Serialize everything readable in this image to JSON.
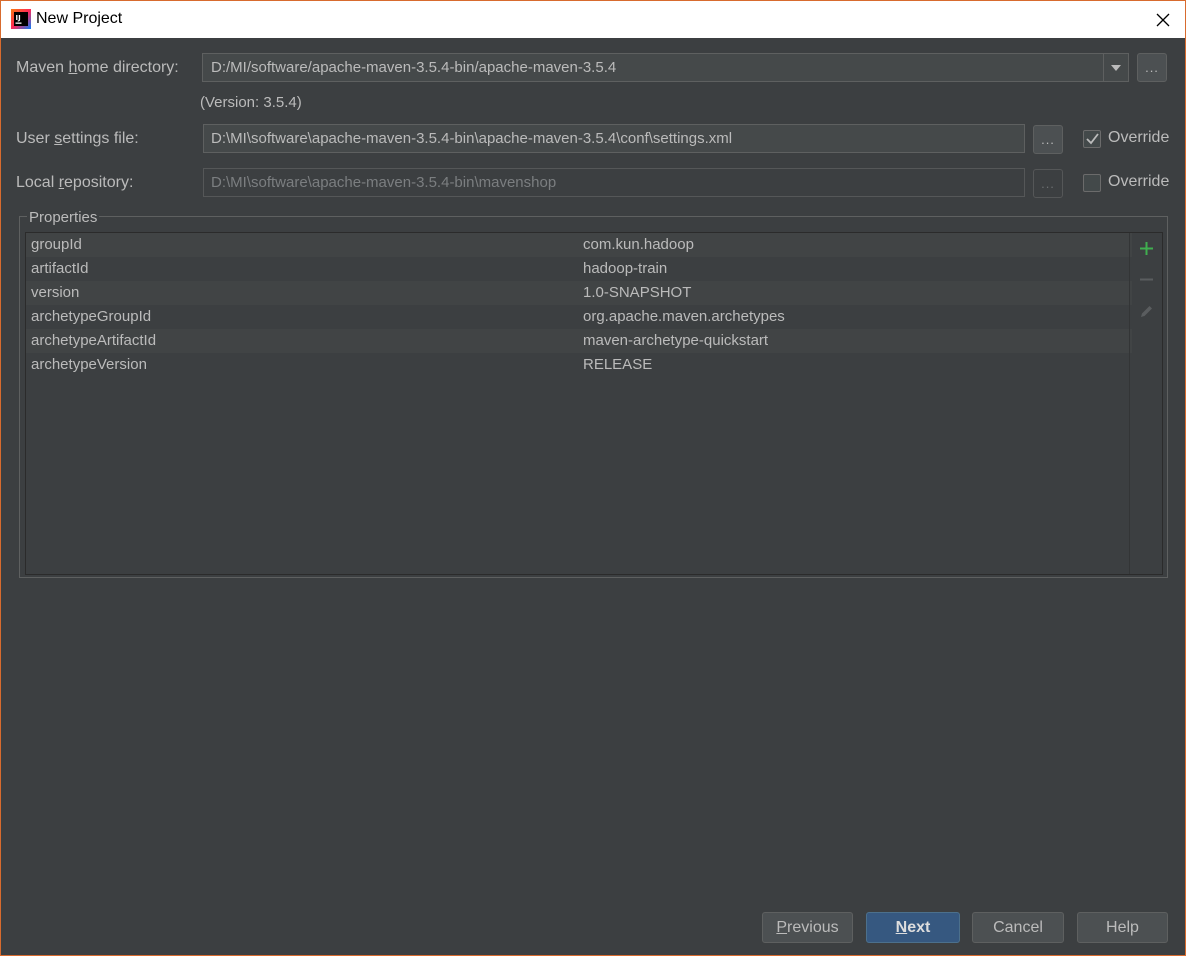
{
  "window": {
    "title": "New Project",
    "accent_color": "#d86b2e",
    "app_icon": "intellij-idea-icon"
  },
  "maven_home": {
    "label_pre": "Maven ",
    "label_mnemonic": "h",
    "label_post": "ome directory:",
    "value": "D:/MI/software/apache-maven-3.5.4-bin/apache-maven-3.5.4",
    "version_text": "(Version: 3.5.4)",
    "browse_label": "..."
  },
  "user_settings": {
    "label_pre": "User ",
    "label_mnemonic": "s",
    "label_post": "ettings file:",
    "value": "D:\\MI\\software\\apache-maven-3.5.4-bin\\apache-maven-3.5.4\\conf\\settings.xml",
    "browse_label": "...",
    "override_label": "Override",
    "override_checked": true
  },
  "local_repo": {
    "label_pre": "Local ",
    "label_mnemonic": "r",
    "label_post": "epository:",
    "value": "D:\\MI\\software\\apache-maven-3.5.4-bin\\mavenshop",
    "browse_label": "...",
    "override_label": "Override",
    "override_checked": false
  },
  "properties": {
    "title": "Properties",
    "rows": [
      {
        "key": "groupId",
        "value": "com.kun.hadoop"
      },
      {
        "key": "artifactId",
        "value": "hadoop-train"
      },
      {
        "key": "version",
        "value": "1.0-SNAPSHOT"
      },
      {
        "key": "archetypeGroupId",
        "value": "org.apache.maven.archetypes"
      },
      {
        "key": "archetypeArtifactId",
        "value": "maven-archetype-quickstart"
      },
      {
        "key": "archetypeVersion",
        "value": "RELEASE"
      }
    ],
    "toolbar": [
      "add-icon",
      "remove-icon",
      "edit-icon"
    ]
  },
  "buttons": {
    "previous_mnemonic": "P",
    "previous_rest": "revious",
    "next_mnemonic": "N",
    "next_rest": "ext",
    "cancel": "Cancel",
    "help": "Help"
  }
}
